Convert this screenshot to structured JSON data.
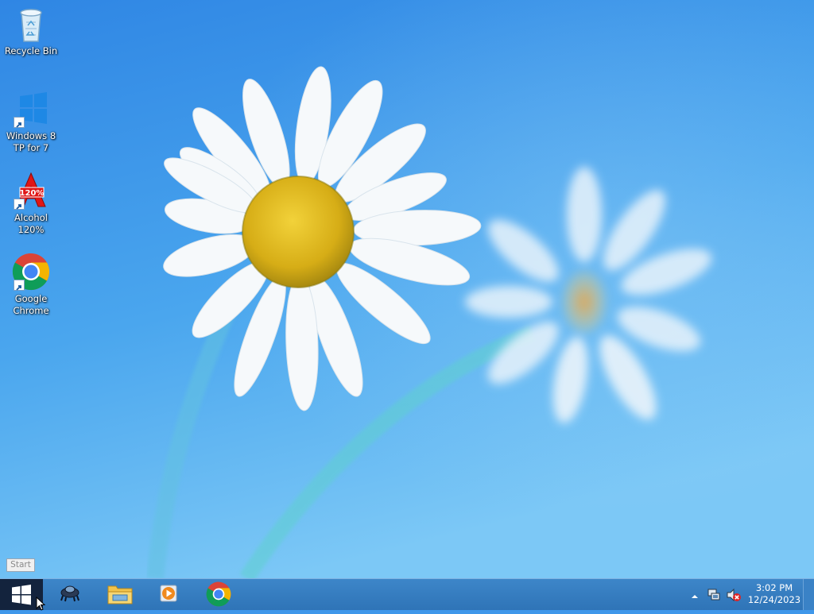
{
  "desktop": {
    "icons": [
      {
        "label": "Recycle Bin",
        "icon": "recycle-bin-icon"
      },
      {
        "label": "Windows 8 TP for 7",
        "icon": "windows-logo-icon"
      },
      {
        "label": "Alcohol 120%",
        "icon": "alcohol-120-icon"
      },
      {
        "label": "Google Chrome",
        "icon": "chrome-icon"
      }
    ]
  },
  "start_tooltip": "Start",
  "taskbar": {
    "pinned": [
      {
        "icon": "alcohol-tray-app-icon"
      },
      {
        "icon": "file-explorer-icon"
      },
      {
        "icon": "media-player-icon"
      },
      {
        "icon": "chrome-icon"
      }
    ],
    "tray": {
      "icons": [
        "show-hidden-icons-chevron",
        "network-icon",
        "volume-muted-icon"
      ],
      "time": "3:02 PM",
      "date": "12/24/2023"
    }
  },
  "colors": {
    "wallpaper_top": "#3a8fe6",
    "wallpaper_bottom": "#6ec2f5",
    "taskbar": "#3079bd",
    "start_button": "#13233d"
  }
}
